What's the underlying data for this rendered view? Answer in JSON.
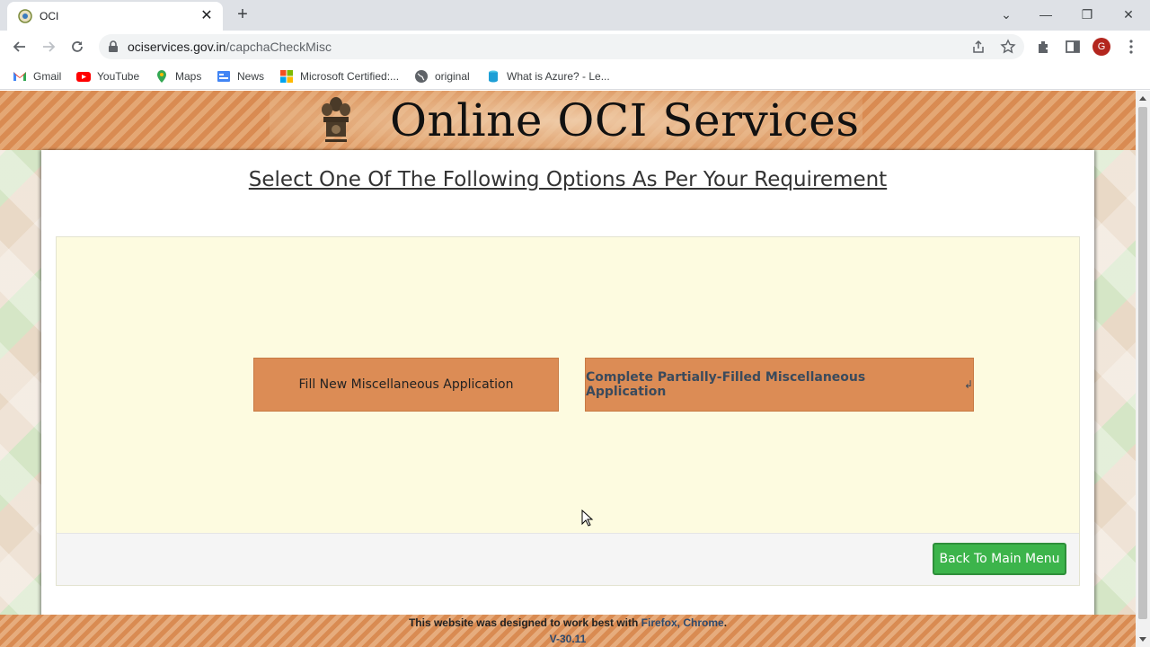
{
  "browser": {
    "tab": {
      "title": "OCI",
      "close": "✕"
    },
    "new_tab": "+",
    "window_controls": {
      "minimize": "—",
      "restore": "❐",
      "close": "✕",
      "tabsearch": "⌄"
    },
    "url": {
      "domain": "ociservices.gov.in",
      "path": "/capchaCheckMisc"
    },
    "profile_initial": "G",
    "bookmarks": [
      {
        "label": "Gmail",
        "icon": "gmail-icon"
      },
      {
        "label": "YouTube",
        "icon": "youtube-icon"
      },
      {
        "label": "Maps",
        "icon": "maps-icon"
      },
      {
        "label": "News",
        "icon": "news-icon"
      },
      {
        "label": "Microsoft Certified:...",
        "icon": "microsoft-icon"
      },
      {
        "label": "original",
        "icon": "globe-icon"
      },
      {
        "label": "What is Azure? - Le...",
        "icon": "azure-icon"
      }
    ]
  },
  "page": {
    "banner_title": "Online OCI Services",
    "heading": "Select One Of The Following Options As Per Your Requirement",
    "buttons": {
      "fill_new": "Fill New Miscellaneous Application",
      "complete_partial": "Complete Partially-Filled Miscellaneous Application",
      "enter_glyph": "↲",
      "back": "Back To Main Menu"
    },
    "footer": {
      "prefix": "This website was designed to work best with ",
      "browsers": "Firefox, Chrome",
      "suffix": ".",
      "version": "V-30.11"
    }
  },
  "colors": {
    "banner": "#d98b52",
    "panel": "#fdfbe0",
    "orange_button": "#dc8c55",
    "green_button": "#3cb44b"
  }
}
